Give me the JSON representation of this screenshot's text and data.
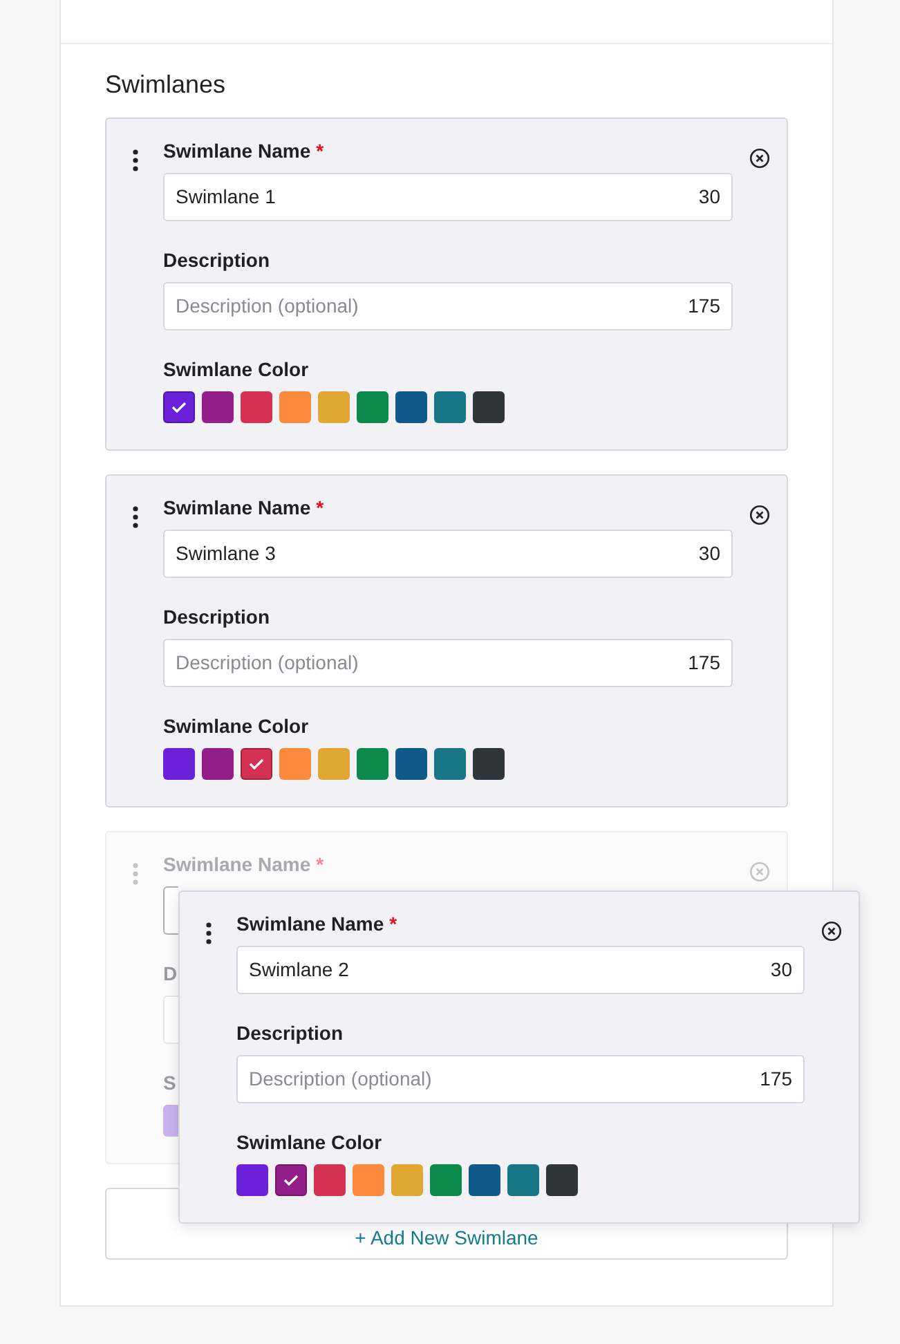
{
  "section_title": "Swimlanes",
  "swimlanes": [
    {
      "name_label": "Swimlane Name",
      "required_mark": "*",
      "name_value": "Swimlane 1",
      "name_limit": "30",
      "description_label": "Description",
      "description_placeholder": "Description (optional)",
      "description_limit": "175",
      "color_label": "Swimlane Color",
      "colors": [
        {
          "color": "#6b21d8",
          "selected": true
        },
        {
          "color": "#93208a",
          "selected": false
        },
        {
          "color": "#d33252",
          "selected": false
        },
        {
          "color": "#fb8a3c",
          "selected": false
        },
        {
          "color": "#e0a735",
          "selected": false
        },
        {
          "color": "#0b8a4c",
          "selected": false
        },
        {
          "color": "#0f5a8a",
          "selected": false
        },
        {
          "color": "#187688",
          "selected": false
        },
        {
          "color": "#30343b",
          "selected": false
        }
      ]
    },
    {
      "name_label": "Swimlane Name",
      "required_mark": "*",
      "name_value": "Swimlane 3",
      "name_limit": "30",
      "description_label": "Description",
      "description_placeholder": "Description (optional)",
      "description_limit": "175",
      "color_label": "Swimlane Color",
      "colors": [
        {
          "color": "#6b21d8",
          "selected": false
        },
        {
          "color": "#93208a",
          "selected": false
        },
        {
          "color": "#d33252",
          "selected": true
        },
        {
          "color": "#fb8a3c",
          "selected": false
        },
        {
          "color": "#e0a735",
          "selected": false
        },
        {
          "color": "#0b8a4c",
          "selected": false
        },
        {
          "color": "#0f5a8a",
          "selected": false
        },
        {
          "color": "#187688",
          "selected": false
        },
        {
          "color": "#30343b",
          "selected": false
        }
      ]
    }
  ],
  "drop_placeholder": {
    "name_label": "Swimlane Name",
    "required_mark": "*",
    "description_label": "D",
    "color_label": "S",
    "colors": [
      {
        "color": "#c9b1ef"
      }
    ]
  },
  "dragged_swimlane": {
    "name_label": "Swimlane Name",
    "required_mark": "*",
    "name_value": "Swimlane 2",
    "name_limit": "30",
    "description_label": "Description",
    "description_placeholder": "Description (optional)",
    "description_limit": "175",
    "color_label": "Swimlane Color",
    "colors": [
      {
        "color": "#6b21d8",
        "selected": false
      },
      {
        "color": "#93208a",
        "selected": true
      },
      {
        "color": "#d33252",
        "selected": false
      },
      {
        "color": "#fb8a3c",
        "selected": false
      },
      {
        "color": "#e0a735",
        "selected": false
      },
      {
        "color": "#0b8a4c",
        "selected": false
      },
      {
        "color": "#0f5a8a",
        "selected": false
      },
      {
        "color": "#187688",
        "selected": false
      },
      {
        "color": "#30343b",
        "selected": false
      }
    ]
  },
  "add_button": "+ Add New Swimlane"
}
